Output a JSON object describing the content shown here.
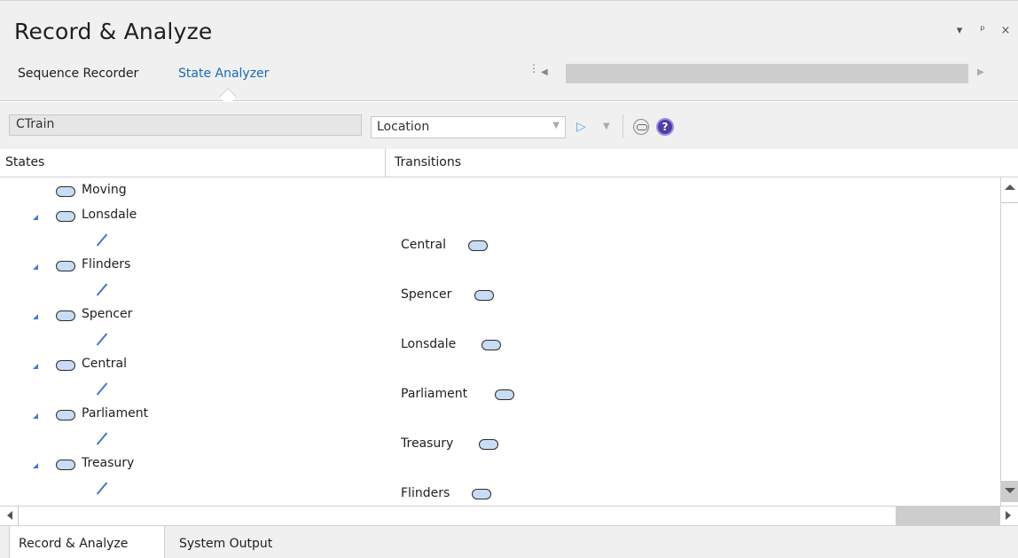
{
  "window": {
    "title": "Record & Analyze",
    "controls": [
      "▾",
      "ᵖ",
      "×"
    ]
  },
  "tabs": {
    "sequence_recorder": "Sequence Recorder",
    "state_analyzer": "State Analyzer",
    "active": "State Analyzer"
  },
  "toolbar": {
    "class_value": "CTrain",
    "location_value": "Location"
  },
  "columns": {
    "states": "States",
    "transitions": "Transitions"
  },
  "tree": {
    "root": "Moving",
    "states": [
      {
        "name": "Lonsdale",
        "transition": "Central"
      },
      {
        "name": "Flinders",
        "transition": "Spencer"
      },
      {
        "name": "Spencer",
        "transition": "Lonsdale"
      },
      {
        "name": "Central",
        "transition": "Parliament"
      },
      {
        "name": "Parliament",
        "transition": "Treasury"
      },
      {
        "name": "Treasury",
        "transition": "Flinders"
      }
    ]
  },
  "bottom_tabs": {
    "record_analyze": "Record & Analyze",
    "system_output": "System Output",
    "active": "Record & Analyze"
  },
  "colors": {
    "accent": "#1a69b5",
    "state_fill": "#c9dcf5",
    "transition_line": "#4a73c8"
  }
}
